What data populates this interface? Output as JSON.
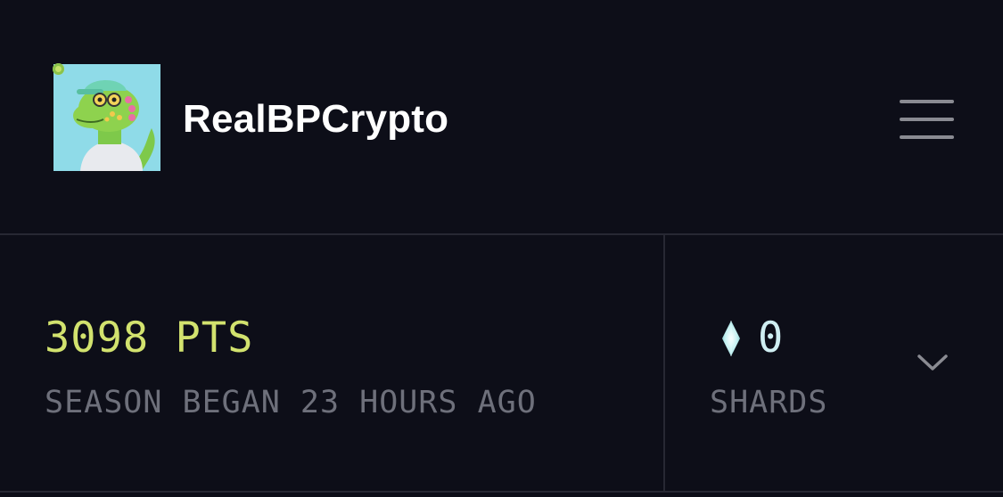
{
  "header": {
    "username": "RealBPCrypto",
    "avatar_icon": "lizard-avatar-icon",
    "online_status": "online",
    "menu_icon": "hamburger-menu-icon"
  },
  "stats": {
    "points": "3098 PTS",
    "season_text": "SEASON BEGAN 23 HOURS AGO"
  },
  "shards": {
    "icon": "shard-crystal-icon",
    "count": "0",
    "label": "SHARDS",
    "expand_icon": "chevron-down-icon"
  },
  "colors": {
    "background": "#0d0e18",
    "divider": "#272833",
    "points": "#d2e26e",
    "muted_text": "#6e707b",
    "shard_count": "#cfeef2",
    "status_dot": "#c4e26a"
  }
}
